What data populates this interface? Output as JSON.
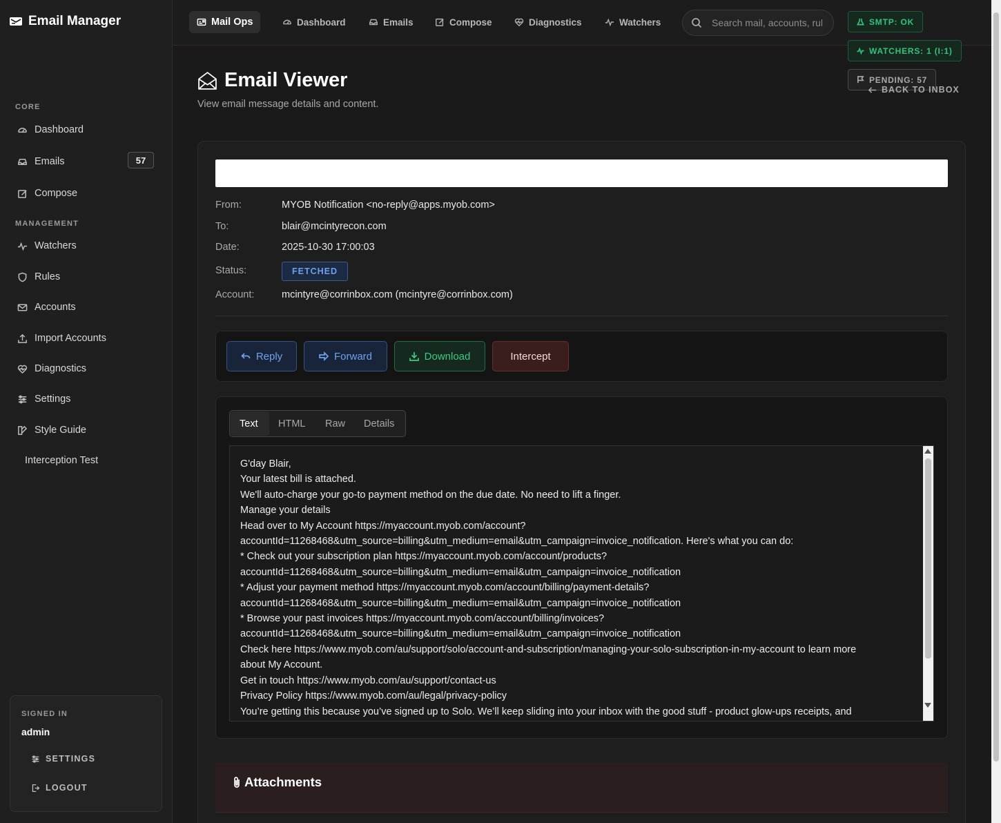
{
  "app": {
    "brand": "Email Manager"
  },
  "sidebar": {
    "section_core": "CORE",
    "section_management": "MANAGEMENT",
    "items": [
      {
        "label": "Dashboard",
        "icon": "dashboard-icon"
      },
      {
        "label": "Emails",
        "icon": "inbox-icon",
        "badge": "57"
      },
      {
        "label": "Compose",
        "icon": "compose-icon"
      },
      {
        "label": "Watchers",
        "icon": "activity-icon"
      },
      {
        "label": "Rules",
        "icon": "shield-icon"
      },
      {
        "label": "Accounts",
        "icon": "mail-icon"
      },
      {
        "label": "Import Accounts",
        "icon": "upload-icon"
      },
      {
        "label": "Diagnostics",
        "icon": "heart-pulse-icon"
      },
      {
        "label": "Settings",
        "icon": "sliders-icon"
      },
      {
        "label": "Style Guide",
        "icon": "brush-icon"
      },
      {
        "label": "Interception Test"
      }
    ],
    "signin": {
      "label": "SIGNED IN",
      "user": "admin",
      "settings": "SETTINGS",
      "logout": "LOGOUT"
    }
  },
  "topbar": {
    "items": [
      {
        "label": "Mail Ops",
        "icon": "envelope-open-icon"
      },
      {
        "label": "Dashboard",
        "icon": "dashboard-icon"
      },
      {
        "label": "Emails",
        "icon": "inbox-icon"
      },
      {
        "label": "Compose",
        "icon": "compose-icon"
      },
      {
        "label": "Diagnostics",
        "icon": "heart-pulse-icon"
      },
      {
        "label": "Watchers",
        "icon": "activity-icon"
      }
    ],
    "search_placeholder": "Search mail, accounts, rules...",
    "smtp": "SMTP: OK",
    "watchers": "WATCHERS: 1 (I:1)",
    "pending": "PENDING: 57",
    "back": "BACK TO INBOX"
  },
  "page": {
    "title": "Email Viewer",
    "subtitle": "View email message details and content."
  },
  "email": {
    "from_label": "From:",
    "from": "MYOB Notification <no-reply@apps.myob.com>",
    "to_label": "To:",
    "to": "blair@mcintyrecon.com",
    "date_label": "Date:",
    "date": "2025-10-30 17:00:03",
    "status_label": "Status:",
    "status": "FETCHED",
    "account_label": "Account:",
    "account": "mcintyre@corrinbox.com (mcintyre@corrinbox.com)"
  },
  "actions": {
    "reply": "Reply",
    "forward": "Forward",
    "download": "Download",
    "intercept": "Intercept"
  },
  "tabs": {
    "text": "Text",
    "html": "HTML",
    "raw": "Raw",
    "details": "Details"
  },
  "body_lines": [
    "G'day Blair,",
    "Your latest bill is attached.",
    "We'll auto-charge your go-to payment method on the due date. No need to lift a finger.",
    "Manage your details",
    "Head over to My Account https://myaccount.myob.com/account?",
    "accountId=11268468&utm_source=billing&utm_medium=email&utm_campaign=invoice_notification. Here's what you can do:",
    "* Check out your subscription plan https://myaccount.myob.com/account/products?",
    "accountId=11268468&utm_source=billing&utm_medium=email&utm_campaign=invoice_notification",
    "* Adjust your payment method https://myaccount.myob.com/account/billing/payment-details?",
    "accountId=11268468&utm_source=billing&utm_medium=email&utm_campaign=invoice_notification",
    "* Browse your past invoices https://myaccount.myob.com/account/billing/invoices?",
    "accountId=11268468&utm_source=billing&utm_medium=email&utm_campaign=invoice_notification",
    "Check here https://www.myob.com/au/support/solo/account-and-subscription/managing-your-solo-subscription-in-my-account to learn more",
    "about My Account.",
    "Get in touch https://www.myob.com/au/support/contact-us",
    "Privacy Policy https://www.myob.com/au/legal/privacy-policy",
    "You’re getting this because you’ve signed up to Solo. We’ll keep sliding into your inbox with the good stuff - product glow-ups receipts, and"
  ],
  "attachments": {
    "title": "Attachments"
  }
}
